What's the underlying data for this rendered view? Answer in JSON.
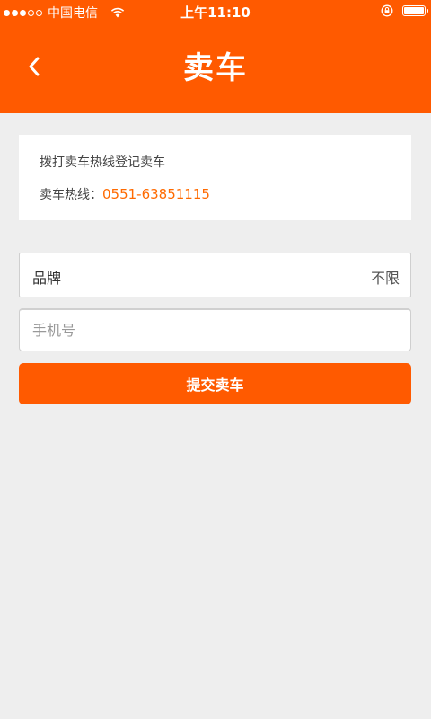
{
  "status_bar": {
    "carrier": "中国电信",
    "time": "上午11:10",
    "icons": [
      "signal-dots-icon",
      "wifi-icon",
      "orientation-lock-icon",
      "battery-icon"
    ]
  },
  "header": {
    "title": "卖车",
    "back_icon": "chevron-left-icon"
  },
  "info": {
    "line1": "拨打卖车热线登记卖车",
    "hotline_label": "卖车热线：",
    "hotline_number": "0551-63851115"
  },
  "form": {
    "brand_label": "品牌",
    "brand_value": "不限",
    "phone_value": "",
    "phone_placeholder": "手机号",
    "submit_label": "提交卖车"
  },
  "colors": {
    "accent": "#ff5a00",
    "hotline": "#ff6a00",
    "background": "#eeeeee"
  }
}
